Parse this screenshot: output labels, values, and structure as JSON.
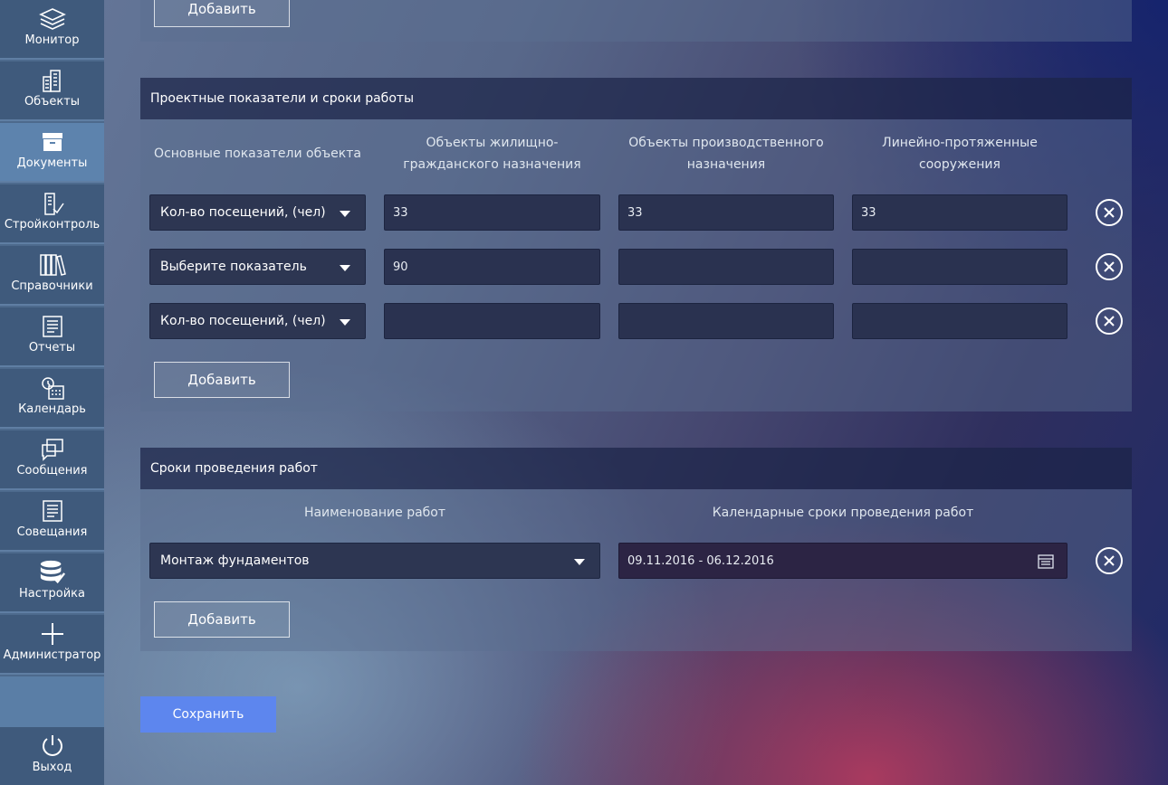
{
  "sidebar": {
    "items": [
      {
        "label": "Монитор",
        "icon": "layers-icon"
      },
      {
        "label": "Объекты",
        "icon": "buildings-icon"
      },
      {
        "label": "Документы",
        "icon": "archive-box-icon"
      },
      {
        "label": "Стройконтроль",
        "icon": "building-check-icon"
      },
      {
        "label": "Справочники",
        "icon": "books-icon"
      },
      {
        "label": "Отчеты",
        "icon": "report-list-icon"
      },
      {
        "label": "Календарь",
        "icon": "calendar-clock-icon"
      },
      {
        "label": "Сообщения",
        "icon": "messages-icon"
      },
      {
        "label": "Совещания",
        "icon": "meeting-list-icon"
      },
      {
        "label": "Настройка",
        "icon": "database-check-icon"
      },
      {
        "label": "Администратор",
        "icon": "plus-icon"
      }
    ],
    "active": "Документы",
    "logout_label": "Выход"
  },
  "top_section": {
    "add_label": "Добавить"
  },
  "indicators": {
    "title": "Проектные показатели и сроки работы",
    "columns": [
      "Основные показатели объекта",
      "Объекты жилищно-гражданского назначения",
      "Объекты производственного назначения",
      "Линейно-протяженные сооружения"
    ],
    "rows": [
      {
        "indicator": "Кол-во посещений, (чел)",
        "values": [
          "33",
          "33",
          "33"
        ]
      },
      {
        "indicator": "Выберите показатель",
        "values": [
          "90",
          "",
          ""
        ]
      },
      {
        "indicator": "Кол-во посещений, (чел)",
        "values": [
          "",
          "",
          ""
        ]
      }
    ],
    "add_label": "Добавить"
  },
  "schedule": {
    "title": "Сроки проведения работ",
    "columns": [
      "Наименование работ",
      "Календарные сроки проведения работ"
    ],
    "rows": [
      {
        "work": "Монтаж фундаментов",
        "dates": "09.11.2016 - 06.12.2016"
      }
    ],
    "add_label": "Добавить"
  },
  "save_label": "Сохранить"
}
